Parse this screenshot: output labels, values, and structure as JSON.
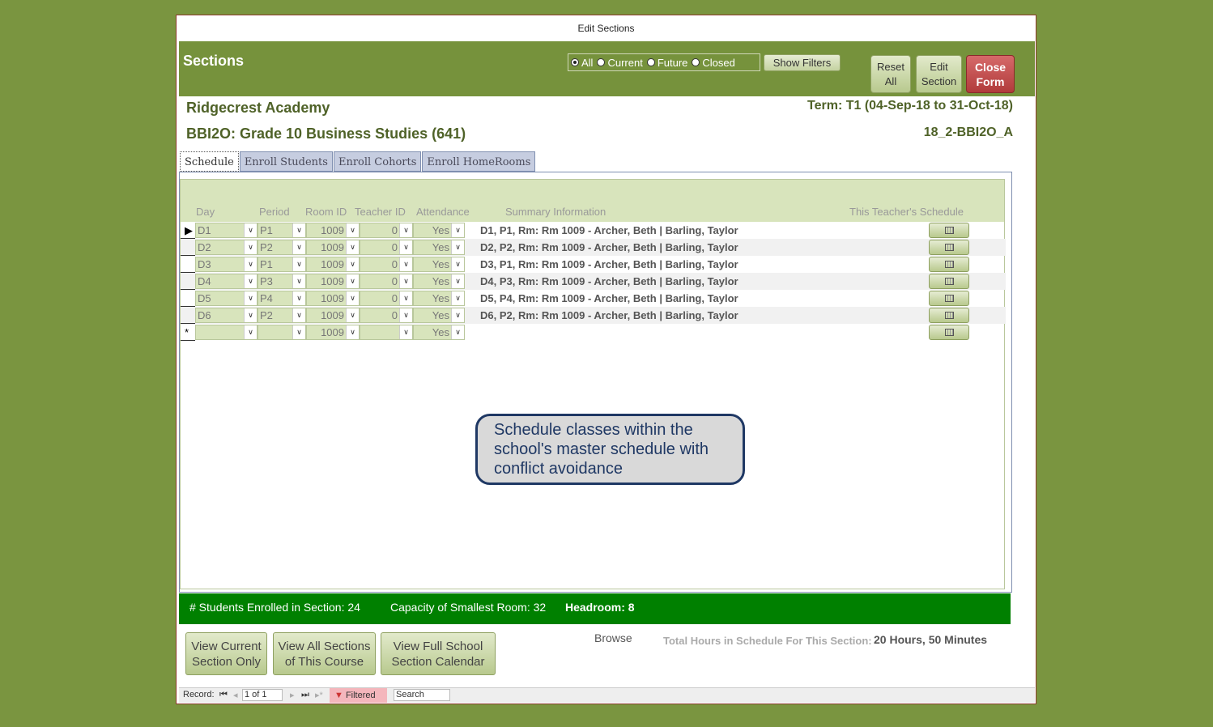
{
  "window": {
    "title": "Edit Sections"
  },
  "header": {
    "title": "Sections",
    "filters": [
      {
        "label": "All",
        "selected": true
      },
      {
        "label": "Current",
        "selected": false
      },
      {
        "label": "Future",
        "selected": false
      },
      {
        "label": "Closed",
        "selected": false
      }
    ],
    "show_filters_label": "Show Filters",
    "reset_all": [
      "Reset",
      "All"
    ],
    "edit_section": [
      "Edit",
      "Section"
    ],
    "close_form": [
      "Close",
      "Form"
    ],
    "colors": {
      "header_bg": "#76923c",
      "close_bg": "#b13b3b"
    }
  },
  "info": {
    "school": "Ridgecrest Academy",
    "course": "BBI2O: Grade 10 Business Studies (641)",
    "term": "Term: T1 (04-Sep-18 to 31-Oct-18)",
    "section_code": "18_2-BBI2O_A"
  },
  "tabs": [
    "Schedule",
    "Enroll Students",
    "Enroll Cohorts",
    "Enroll HomeRooms"
  ],
  "grid": {
    "columns": [
      "Day",
      "Period",
      "Room ID",
      "Teacher ID",
      "Attendance",
      "Summary Information",
      "This Teacher's Schedule"
    ],
    "rows": [
      {
        "day": "D1",
        "period": "P1",
        "room": "1009",
        "teacher": "0",
        "attendance": "Yes",
        "summary": "D1, P1, Rm: Rm 1009 - Archer, Beth | Barling, Taylor"
      },
      {
        "day": "D2",
        "period": "P2",
        "room": "1009",
        "teacher": "0",
        "attendance": "Yes",
        "summary": "D2, P2, Rm: Rm 1009 - Archer, Beth | Barling, Taylor"
      },
      {
        "day": "D3",
        "period": "P1",
        "room": "1009",
        "teacher": "0",
        "attendance": "Yes",
        "summary": "D3, P1, Rm: Rm 1009 - Archer, Beth | Barling, Taylor"
      },
      {
        "day": "D4",
        "period": "P3",
        "room": "1009",
        "teacher": "0",
        "attendance": "Yes",
        "summary": "D4, P3, Rm: Rm 1009 - Archer, Beth | Barling, Taylor"
      },
      {
        "day": "D5",
        "period": "P4",
        "room": "1009",
        "teacher": "0",
        "attendance": "Yes",
        "summary": "D5, P4, Rm: Rm 1009 - Archer, Beth | Barling, Taylor"
      },
      {
        "day": "D6",
        "period": "P2",
        "room": "1009",
        "teacher": "0",
        "attendance": "Yes",
        "summary": "D6, P2, Rm: Rm 1009 - Archer, Beth | Barling, Taylor"
      },
      {
        "day": "",
        "period": "",
        "room": "1009",
        "teacher": "",
        "attendance": "Yes",
        "summary": "",
        "new": true
      }
    ]
  },
  "callout": "Schedule classes within the school's master schedule with conflict avoidance",
  "status": {
    "enrolled": "# Students Enrolled in Section: 24",
    "capacity": "Capacity of Smallest Room: 32",
    "headroom": "Headroom: 8"
  },
  "buttons": {
    "view_current": [
      "View Current",
      "Section Only"
    ],
    "view_all": [
      "View All Sections",
      "of This Course"
    ],
    "view_full": [
      "View Full School",
      "Section Calendar"
    ]
  },
  "browse": "Browse",
  "total": {
    "label": "Total Hours in Schedule For This Section:",
    "value": "20 Hours, 50 Minutes"
  },
  "nav": {
    "record_label": "Record:",
    "position": "1 of 1",
    "filtered": "Filtered",
    "search": "Search"
  }
}
